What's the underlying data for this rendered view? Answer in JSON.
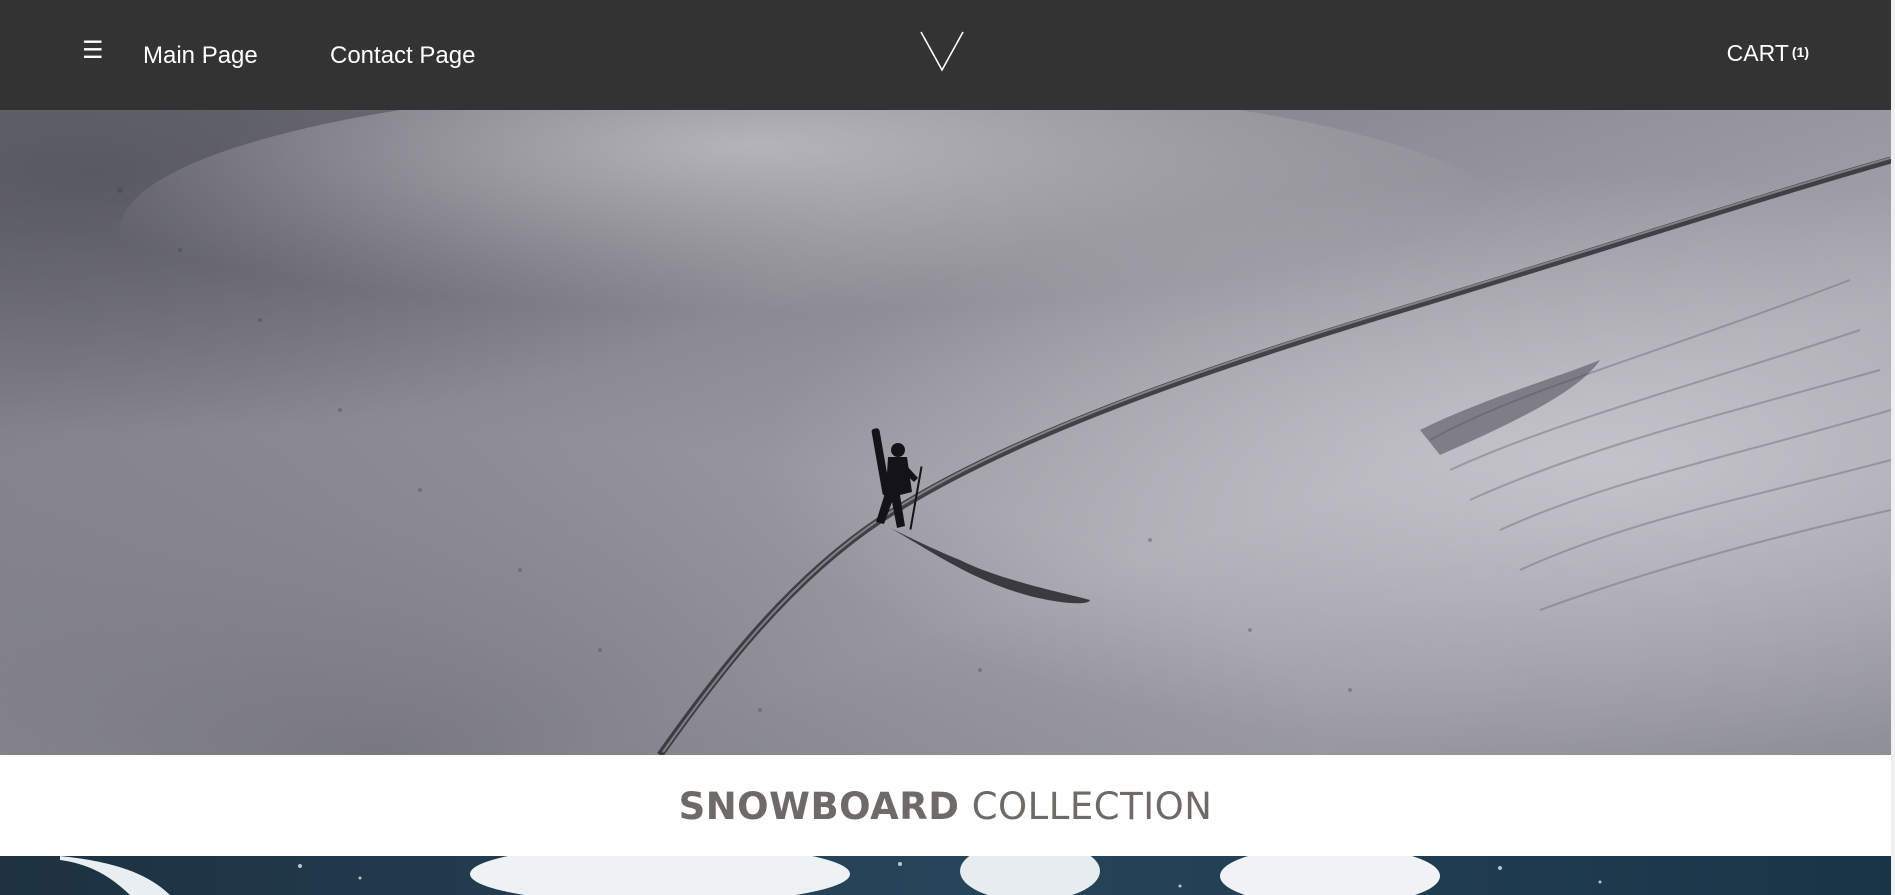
{
  "header": {
    "menu_icon": "hamburger-menu-icon",
    "nav": [
      {
        "label": "Main Page"
      },
      {
        "label": "Contact Page"
      }
    ],
    "logo_icon": "v-logo-icon",
    "cart": {
      "label": "CART",
      "count": "(1)"
    }
  },
  "hero": {
    "image": "snowboarder-hiking-snowy-slope"
  },
  "collection": {
    "title_bold": "SNOWBOARD",
    "title_rest": "COLLECTION"
  },
  "banner2": {
    "image": "ocean-wave-splash"
  },
  "colors": {
    "header_bg": "#333333",
    "header_text": "#ffffff",
    "title_text": "#6e6a67"
  }
}
